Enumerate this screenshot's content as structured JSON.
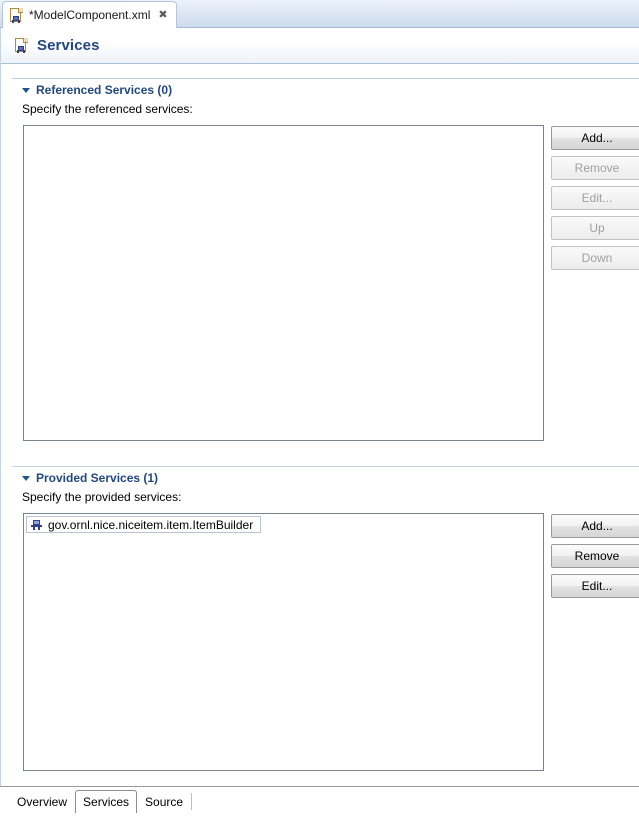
{
  "editor": {
    "tab": {
      "label": "*ModelComponent.xml",
      "icon": "xml-component-file-icon",
      "close_glyph": "✖"
    }
  },
  "header": {
    "title": "Services",
    "icon": "services-page-icon"
  },
  "sections": [
    {
      "id": "referenced-services",
      "title": "Referenced Services (0)",
      "description": "Specify the referenced services:",
      "expanded": true,
      "items": [],
      "buttons": [
        {
          "label": "Add...",
          "enabled": true
        },
        {
          "label": "Remove",
          "enabled": false
        },
        {
          "label": "Edit...",
          "enabled": false
        },
        {
          "label": "Up",
          "enabled": false
        },
        {
          "label": "Down",
          "enabled": false
        }
      ]
    },
    {
      "id": "provided-services",
      "title": "Provided Services (1)",
      "description": "Specify the provided services:",
      "expanded": true,
      "items": [
        {
          "label": "gov.ornl.nice.niceitem.item.ItemBuilder",
          "icon": "service-component-icon"
        }
      ],
      "buttons": [
        {
          "label": "Add...",
          "enabled": true
        },
        {
          "label": "Remove",
          "enabled": true
        },
        {
          "label": "Edit...",
          "enabled": true
        }
      ]
    }
  ],
  "page_tabs": [
    {
      "label": "Overview",
      "selected": false
    },
    {
      "label": "Services",
      "selected": true
    },
    {
      "label": "Source",
      "selected": false
    }
  ],
  "colors": {
    "header_title": "#22487f",
    "section_title": "#22487f",
    "tabstrip_top": "#eef3fa",
    "tabstrip_bottom": "#ccdcee",
    "listbox_border": "#7c828c",
    "button_border": "#9a9a9a",
    "disabled_text": "#a0a0a0"
  }
}
